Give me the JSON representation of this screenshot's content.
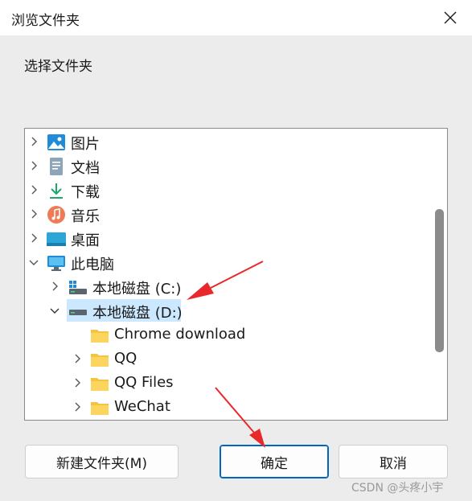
{
  "window": {
    "title": "浏览文件夹",
    "close_icon": "close-icon"
  },
  "prompt": "选择文件夹",
  "tree": {
    "items": [
      {
        "label": "图片",
        "icon": "pictures-icon",
        "expanded": false
      },
      {
        "label": "文档",
        "icon": "documents-icon",
        "expanded": false
      },
      {
        "label": "下载",
        "icon": "downloads-icon",
        "expanded": false
      },
      {
        "label": "音乐",
        "icon": "music-icon",
        "expanded": false
      },
      {
        "label": "桌面",
        "icon": "desktop-icon",
        "expanded": false
      },
      {
        "label": "此电脑",
        "icon": "this-pc-icon",
        "expanded": true
      },
      {
        "label": "本地磁盘 (C:)",
        "icon": "windows-drive-icon",
        "expanded": false
      },
      {
        "label": "本地磁盘 (D:)",
        "icon": "drive-icon",
        "expanded": true,
        "selected": true
      },
      {
        "label": "Chrome download",
        "icon": "folder-icon"
      },
      {
        "label": "QQ",
        "icon": "folder-icon",
        "expanded": false
      },
      {
        "label": "QQ Files",
        "icon": "folder-icon",
        "expanded": false
      },
      {
        "label": "WeChat",
        "icon": "folder-icon",
        "expanded": false
      }
    ]
  },
  "buttons": {
    "new_folder": "新建文件夹(M)",
    "ok": "确定",
    "cancel": "取消"
  },
  "watermark": "CSDN @头疼小宇",
  "colors": {
    "selection": "#cce8ff",
    "primary_border": "#0067c0",
    "annotation_arrow": "#e8282b",
    "folder": "#f5c342"
  }
}
